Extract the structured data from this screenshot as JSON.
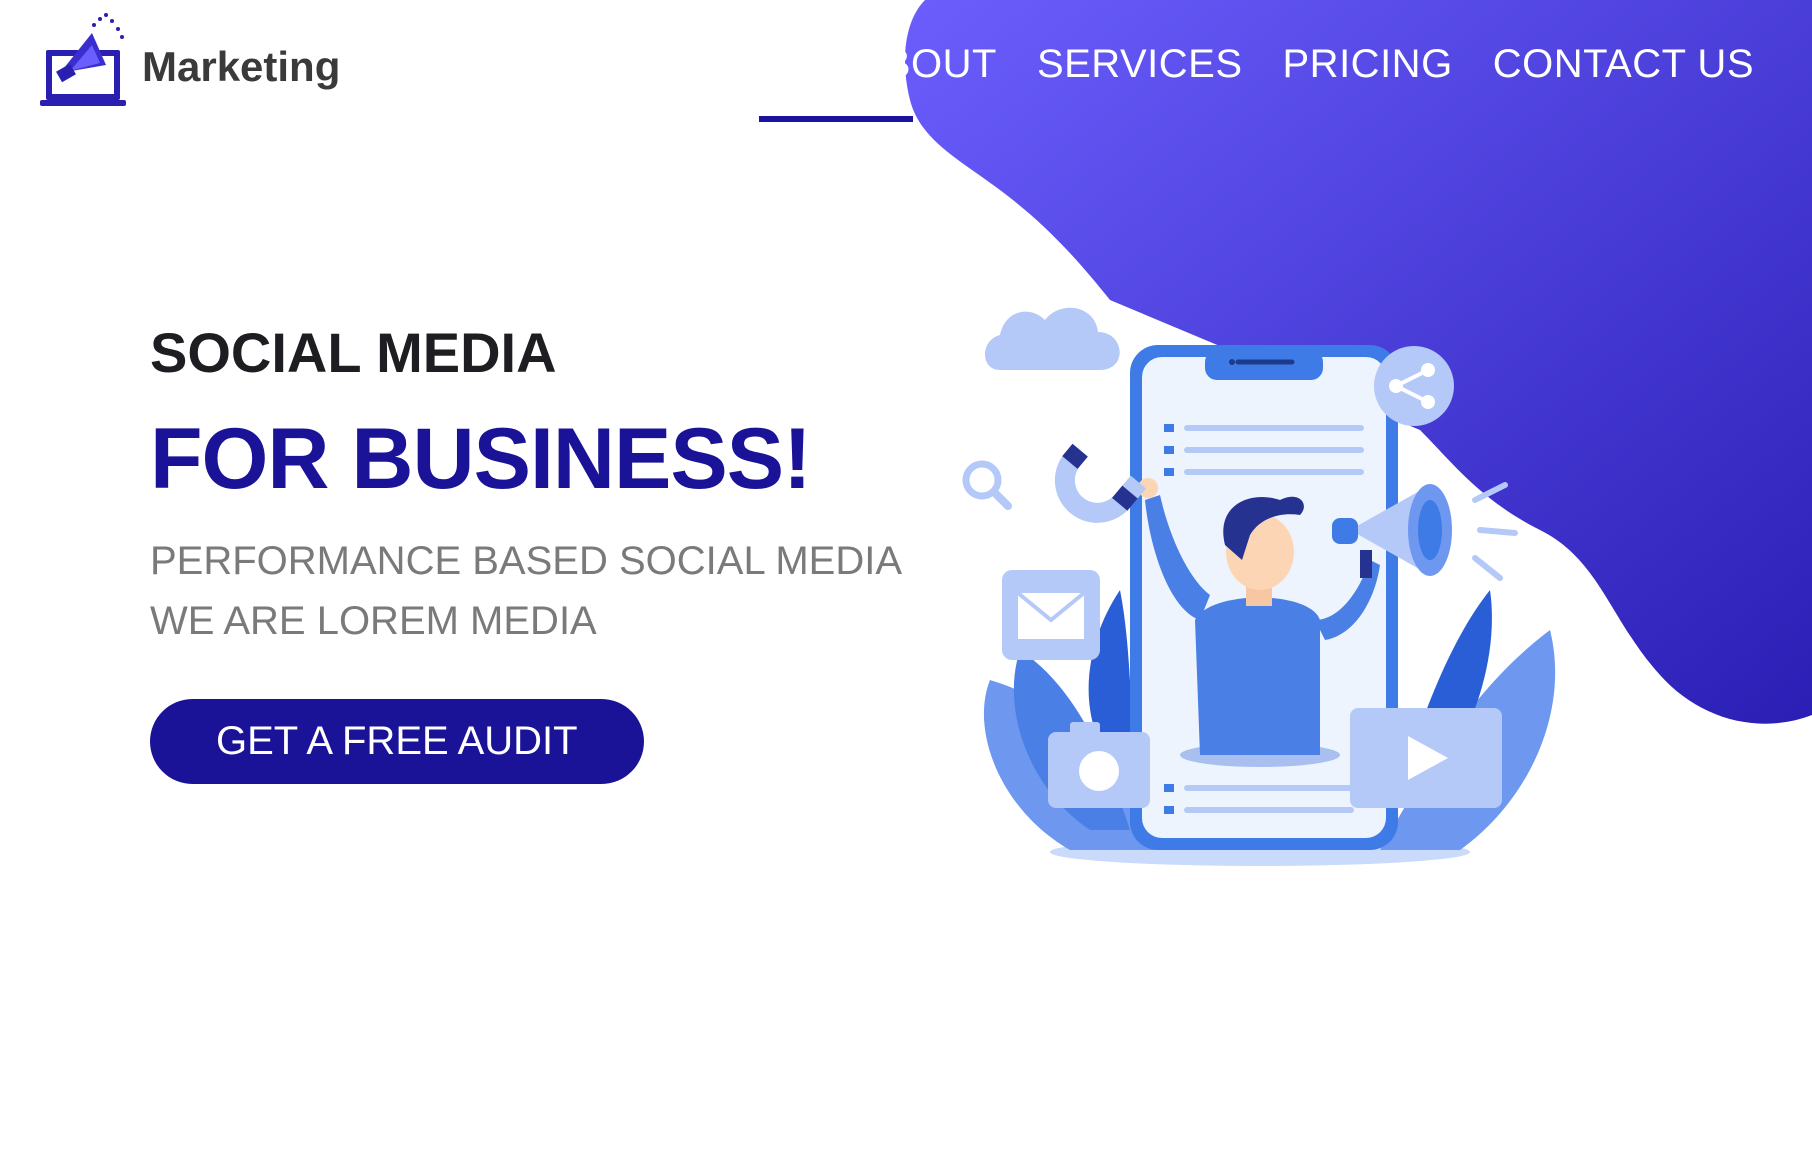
{
  "brand": {
    "name": "Marketing",
    "logo_icon": "megaphone-laptop-icon"
  },
  "nav": {
    "items": [
      "ABOUT",
      "SERVICES",
      "PRICING",
      "CONTACT US"
    ]
  },
  "hero": {
    "kicker": "SOCIAL MEDIA",
    "title": "FOR BUSINESS!",
    "subtitle_line1": "PERFORMANCE BASED SOCIAL MEDIA",
    "subtitle_line2": "WE ARE LOREM MEDIA",
    "cta_label": "GET A FREE AUDIT"
  },
  "colors": {
    "brand_dark": "#1a1398",
    "blob_start": "#6659fb",
    "blob_end": "#2a20b8",
    "text_dark": "#1e1e22",
    "text_muted": "#7a7a7a",
    "illustration_blue": "#4a7fe6",
    "illustration_light": "#b4c9f7"
  },
  "illustration": {
    "icons": [
      "cloud-icon",
      "share-icon",
      "search-icon",
      "magnet-icon",
      "mail-icon",
      "camera-icon",
      "play-icon",
      "megaphone-icon",
      "person-icon",
      "smartphone-icon",
      "leaf-icon"
    ]
  }
}
